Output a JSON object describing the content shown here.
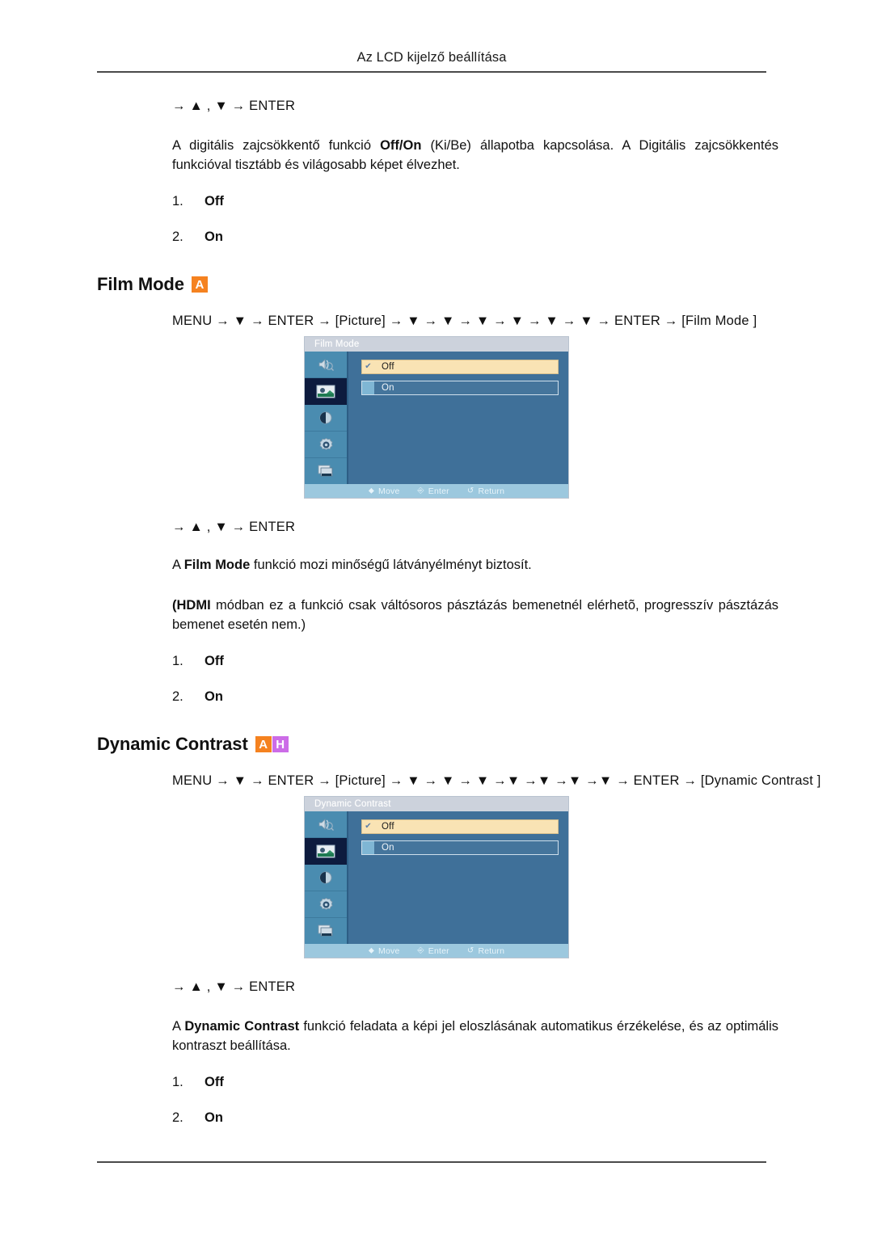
{
  "page": {
    "header_title": "Az LCD kijelző beállítása"
  },
  "digital_nr_section": {
    "nav_line": "→ ▲ , ▼ → ENTER",
    "description_part1": "A digitális zajcsökkentő funkció ",
    "description_bold": "Off/On",
    "description_part2": " (Ki/Be) állapotba kapcsolása. A Digitális zajcsökkentés funkcióval tisztább és világosabb képet élvezhet.",
    "options": [
      {
        "num": "1.",
        "label": "Off"
      },
      {
        "num": "2.",
        "label": "On"
      }
    ]
  },
  "film_mode_section": {
    "heading": "Film Mode",
    "badges": [
      {
        "letter": "A",
        "color": "#F58220"
      }
    ],
    "menu_path": "MENU → ▼ → ENTER → [Picture] → ▼ → ▼ → ▼ → ▼ → ▼ → ▼ → ENTER → [Film Mode ]",
    "osd": {
      "title": "Film Mode",
      "rail_icons": [
        "sound-icon",
        "picture-icon",
        "contrast-icon",
        "setup-icon",
        "multi-control-icon"
      ],
      "selected_rail_index": 1,
      "options": [
        {
          "label": "Off",
          "state": "checked"
        },
        {
          "label": "On",
          "state": "unchecked"
        }
      ],
      "footer": [
        {
          "glyph": "move-icon",
          "label": "Move"
        },
        {
          "glyph": "enter-icon",
          "label": "Enter"
        },
        {
          "glyph": "return-icon",
          "label": "Return"
        }
      ]
    },
    "nav_line": "→ ▲ , ▼ → ENTER",
    "desc_prefix": "A ",
    "desc_bold": "Film Mode",
    "desc_suffix": " funkció mozi minőségű látványélményt biztosít.",
    "note_bold": "(HDMI",
    "note_rest": " módban ez a funkció csak váltósoros pásztázás bemenetnél elérhetõ, progresszív pásztázás bemenet esetén nem.)",
    "options": [
      {
        "num": "1.",
        "label": "Off"
      },
      {
        "num": "2.",
        "label": "On"
      }
    ]
  },
  "dynamic_contrast_section": {
    "heading": "Dynamic Contrast",
    "badges": [
      {
        "letter": "A",
        "color": "#F58220"
      },
      {
        "letter": "H",
        "color": "#CC6CE7"
      }
    ],
    "menu_path": "MENU → ▼ → ENTER → [Picture] → ▼ → ▼ → ▼ →▼ →▼ →▼ →▼ → ENTER → [Dynamic Contrast ]",
    "osd": {
      "title": "Dynamic Contrast",
      "rail_icons": [
        "sound-icon",
        "picture-icon",
        "contrast-icon",
        "setup-icon",
        "multi-control-icon"
      ],
      "selected_rail_index": 1,
      "options": [
        {
          "label": "Off",
          "state": "checked"
        },
        {
          "label": "On",
          "state": "unchecked"
        }
      ],
      "footer": [
        {
          "glyph": "move-icon",
          "label": "Move"
        },
        {
          "glyph": "enter-icon",
          "label": "Enter"
        },
        {
          "glyph": "return-icon",
          "label": "Return"
        }
      ]
    },
    "nav_line": "→ ▲ , ▼ → ENTER",
    "desc_prefix": "A ",
    "desc_bold": "Dynamic Contrast",
    "desc_suffix": " funkció feladata a képi jel eloszlásának automatikus érzékelése, és az optimális kontraszt beállítása.",
    "options": [
      {
        "num": "1.",
        "label": "Off"
      },
      {
        "num": "2.",
        "label": "On"
      }
    ]
  }
}
